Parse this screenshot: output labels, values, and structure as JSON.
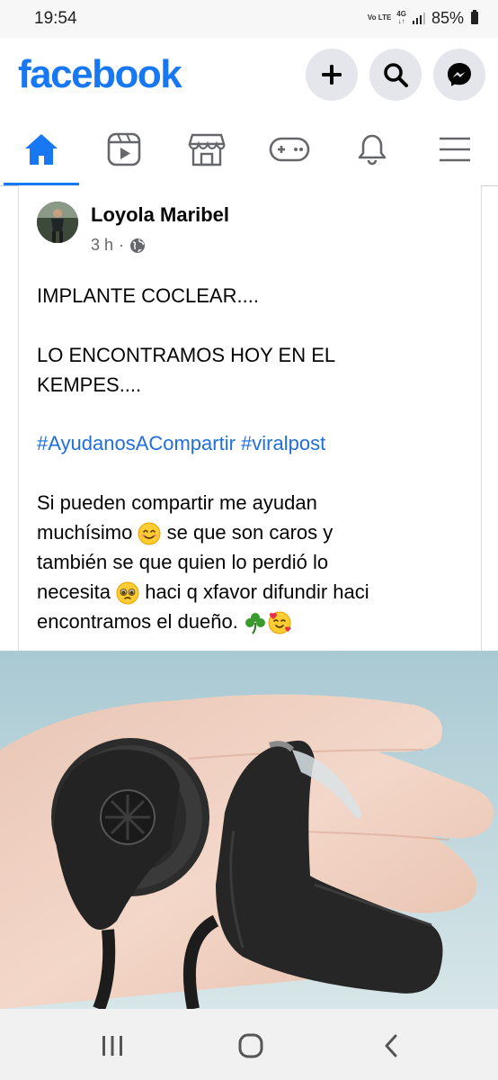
{
  "status_bar": {
    "time": "19:54",
    "volte": "Vo LTE",
    "network": "4G",
    "battery": "85%"
  },
  "header": {
    "logo": "facebook",
    "brand_color": "#1877f2",
    "actions": [
      "plus-icon",
      "search-icon",
      "messenger-icon"
    ]
  },
  "nav_tabs": [
    {
      "name": "home",
      "icon": "home-icon",
      "active": true
    },
    {
      "name": "watch",
      "icon": "video-icon",
      "active": false
    },
    {
      "name": "marketplace",
      "icon": "store-icon",
      "active": false
    },
    {
      "name": "gaming",
      "icon": "gamepad-icon",
      "active": false
    },
    {
      "name": "notifications",
      "icon": "bell-icon",
      "active": false
    },
    {
      "name": "menu",
      "icon": "menu-icon",
      "active": false
    }
  ],
  "post": {
    "author": "Loyola Maribel",
    "time": "3 h",
    "separator": "·",
    "privacy_icon": "globe-icon",
    "lines": {
      "p1": "IMPLANTE COCLEAR....",
      "p2a": "LO ENCONTRAMOS HOY EN EL",
      "p2b": "KEMPES....",
      "hashtags": "#AyudanosACompartir #viralpost",
      "p4a": "Si pueden compartir me ayudan",
      "p4b_pre": "muchísimo",
      "p4b_post": "se que son caros y",
      "p4c": "también se que quien lo perdió lo",
      "p4d_pre": "necesita",
      "p4d_post": "haci q xfavor difundir haci",
      "p4e": "encontramos el dueño."
    },
    "emojis": [
      "smiling-face-icon",
      "pleading-face-icon",
      "clover-icon",
      "heart-face-icon"
    ],
    "hashtag_color": "#216fdb"
  },
  "photo": {
    "subject": "cochlear-implant-photo"
  },
  "system_nav": [
    "recents-icon",
    "home-circle-icon",
    "back-icon"
  ]
}
